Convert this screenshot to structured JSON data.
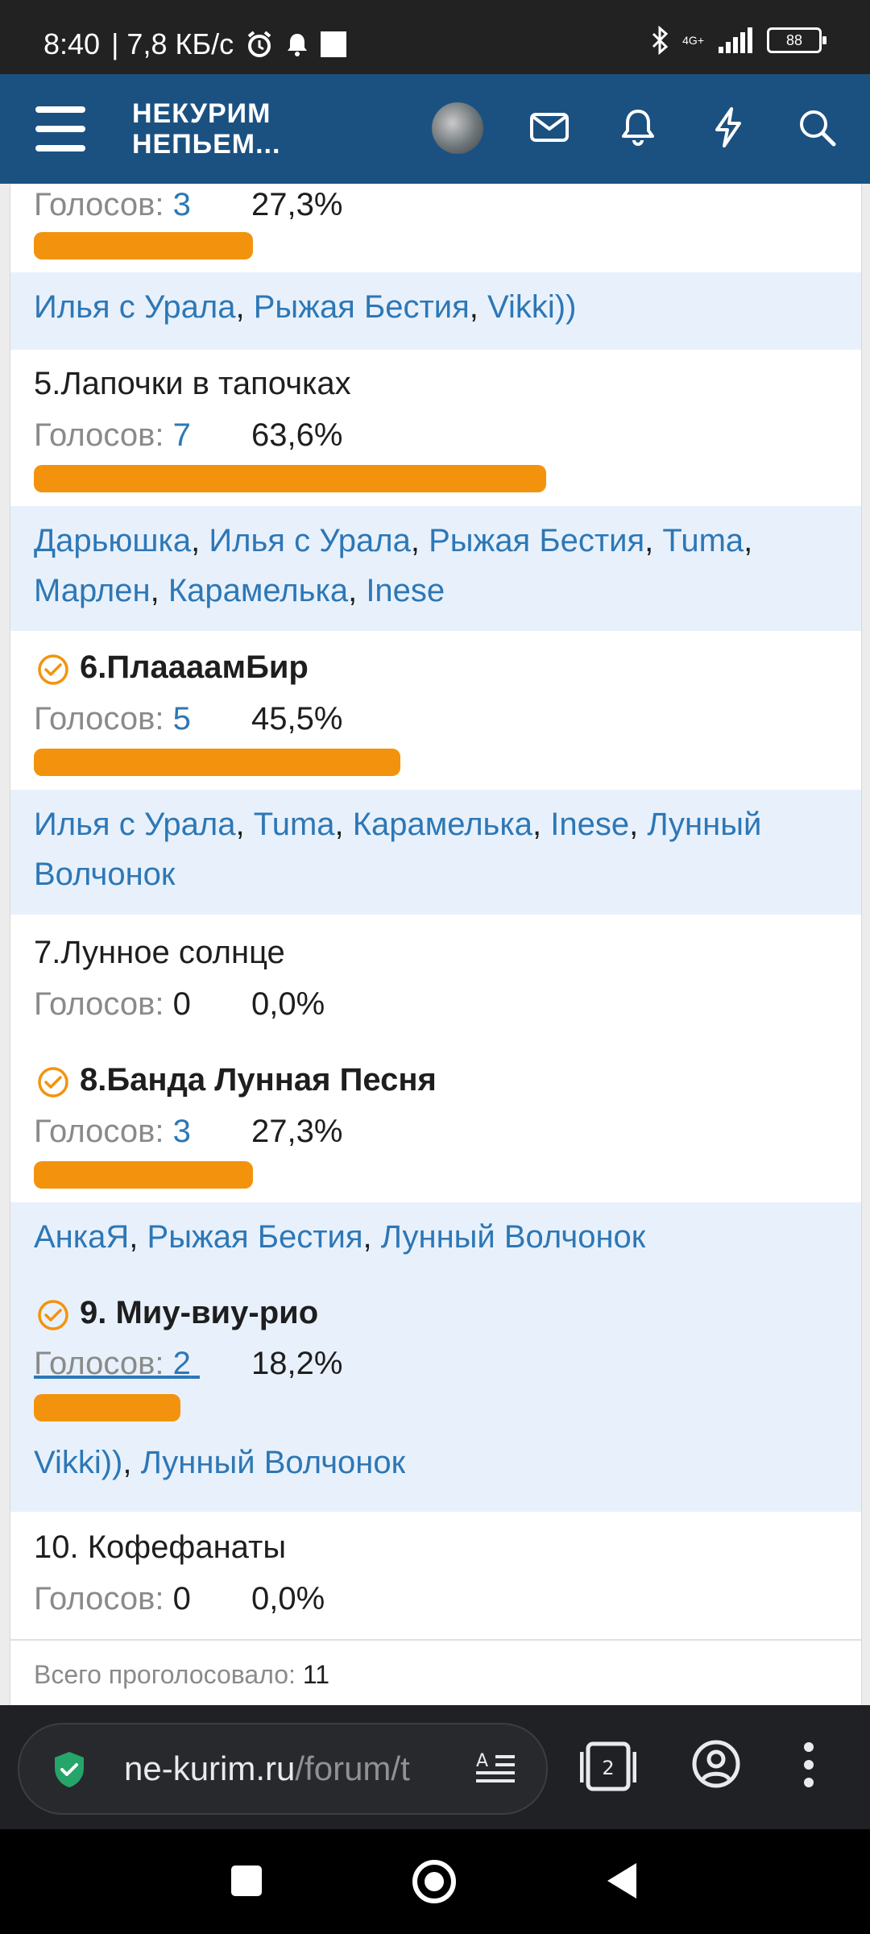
{
  "status_bar": {
    "time": "8:40",
    "speed": "| 7,8 КБ/с",
    "network": "4G+",
    "battery": "88"
  },
  "header": {
    "logo_line1": "НЕКУРИМ",
    "logo_line2": "НЕПЬЕМ..."
  },
  "poll": {
    "item_prev": {
      "votes_label": "Голосов:",
      "votes": "3",
      "percent": "27,3%",
      "fraction": 0.273
    },
    "voters_prev": [
      "Илья с Урала",
      "Рыжая Бестия",
      "Vikki))"
    ],
    "item5": {
      "title": "5.Лапочки в тапочках",
      "votes_label": "Голосов:",
      "votes": "7",
      "percent": "63,6%",
      "fraction": 0.636
    },
    "voters5": [
      "Дарьюшка",
      "Илья с Урала",
      "Рыжая Бестия",
      "Tuma",
      "Марлен",
      "Карамелька",
      "Inese"
    ],
    "item6": {
      "title": "6.ПлаааамБир",
      "votes_label": "Голосов:",
      "votes": "5",
      "percent": "45,5%",
      "fraction": 0.455,
      "selected": true
    },
    "voters6": [
      "Илья с Урала",
      "Tuma",
      "Карамелька",
      "Inese",
      "Лунный Волчонок"
    ],
    "item7": {
      "title": "7.Лунное солнце",
      "votes_label": "Голосов:",
      "votes": "0",
      "percent": "0,0%"
    },
    "item8": {
      "title": "8.Банда Лунная Песня",
      "votes_label": "Голосов:",
      "votes": "3",
      "percent": "27,3%",
      "fraction": 0.273,
      "selected": true
    },
    "voters8": [
      "АнкаЯ",
      "Рыжая Бестия",
      "Лунный Волчонок"
    ],
    "item9": {
      "title": "9. Миу-виу-рио",
      "votes_label": "Голосов:",
      "votes": "2",
      "percent": "18,2%",
      "fraction": 0.182,
      "selected": true
    },
    "voters9": [
      "Vikki))",
      "Лунный Волчонок"
    ],
    "item10": {
      "title": "10. Кофефанаты",
      "votes_label": "Голосов:",
      "votes": "0",
      "percent": "0,0%"
    },
    "total_label": "Всего проголосовало:",
    "total": "11"
  },
  "browser": {
    "url_main": "ne-kurim.ru",
    "url_path": "/forum/t",
    "tab_count": "2"
  },
  "colors": {
    "header": "#1b5181",
    "bar": "#f3930d",
    "link": "#2d77b6",
    "voters_bg": "#e8f1fb"
  }
}
